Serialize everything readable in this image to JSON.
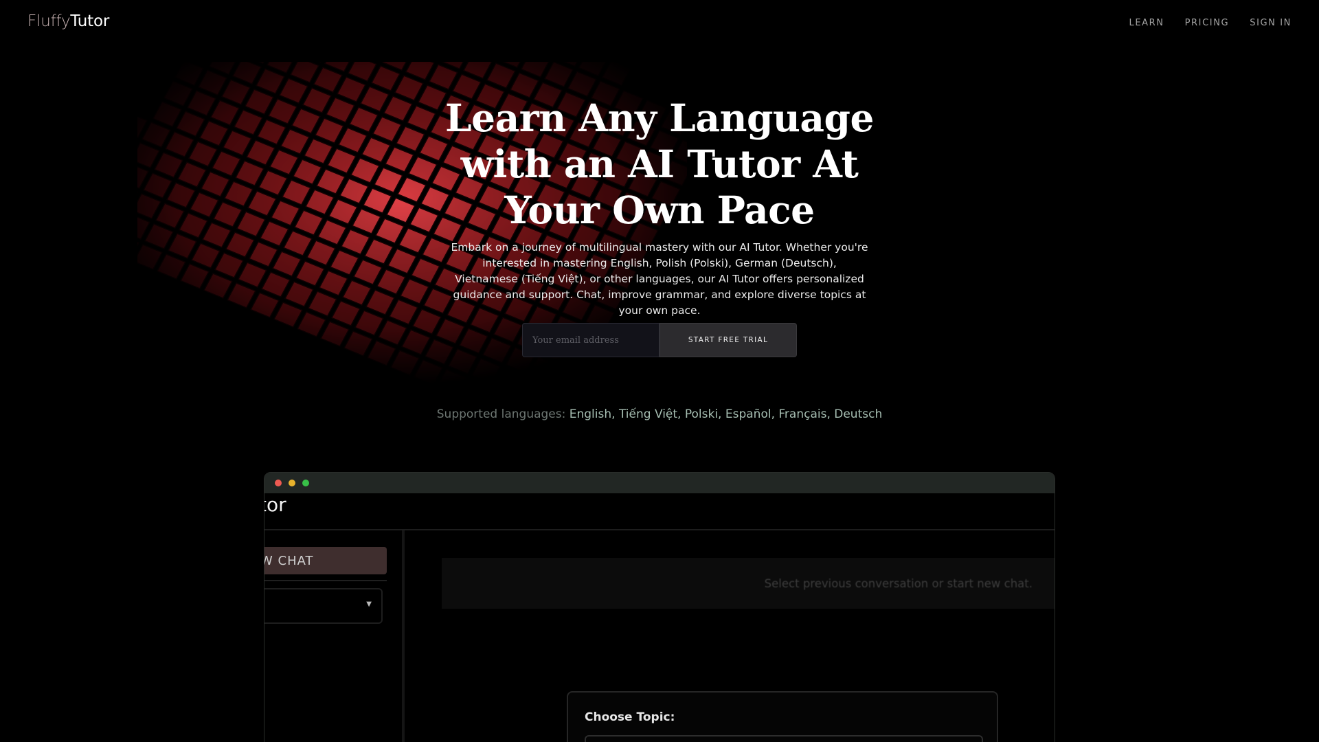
{
  "brand": {
    "part1": "Fluffy",
    "part2": "Tutor"
  },
  "nav": {
    "items": [
      "LEARN",
      "PRICING",
      "SIGN IN"
    ]
  },
  "hero": {
    "title": "Learn Any Language with an AI Tutor At Your Own Pace",
    "subtitle": "Embark on a journey of multilingual mastery with our AI Tutor. Whether you're interested in mastering English, Polish (Polski), German (Deutsch), Vietnamese (Tiếng Việt), or other languages, our AI Tutor offers personalized guidance and support. Chat, improve grammar, and explore diverse topics at your own pace.",
    "email_placeholder": "Your email address",
    "cta_label": "START FREE TRIAL"
  },
  "languages": {
    "label": "Supported languages:",
    "list": "English, Tiếng Việt, Polski, Español, Français, Deutsch"
  },
  "preview": {
    "app_title": "tor",
    "new_chat_label": "W CHAT",
    "banner_text": "Select previous conversation or start new chat.",
    "topic_label": "Choose Topic:"
  },
  "colors": {
    "background": "#000000",
    "tile_red": "#b3262a",
    "cta_bg": "#2c2b2e",
    "languages_accent": "#a6beb2",
    "new_chat_bg": "#3f2e2e"
  }
}
